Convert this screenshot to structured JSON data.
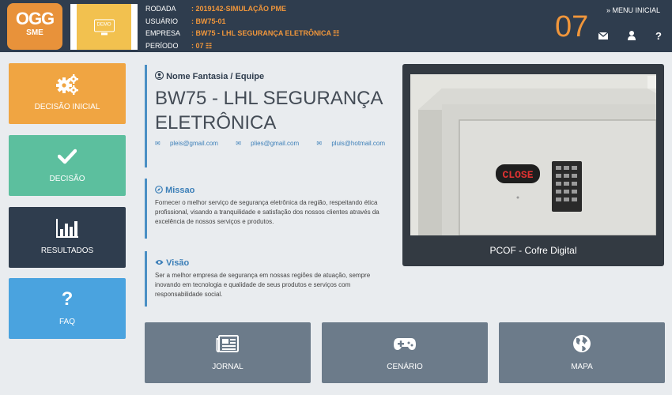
{
  "header": {
    "logo_line1": "OGG",
    "logo_line2": "SME",
    "demo_label": "DEMO",
    "info": [
      {
        "label": "RODADA",
        "value": ": 2019142-SIMULAÇÃO PME"
      },
      {
        "label": "USUÁRIO",
        "value": ": BW75-01"
      },
      {
        "label": "EMPRESA",
        "value": ": BW75 - LHL SEGURANÇA ELETRÔNICA ☷"
      },
      {
        "label": "PERÍODO",
        "value": ": 07 ☷"
      }
    ],
    "period_big": "07",
    "menu_inicial": "» MENU INICIAL",
    "icons": [
      "envelope-icon",
      "user-icon",
      "question-icon"
    ]
  },
  "sidebar": {
    "items": [
      {
        "label": "DECISÃO INICIAL",
        "color": "#f0a542",
        "icon": "gears-icon"
      },
      {
        "label": "DECISÃO",
        "color": "#5cbf9e",
        "icon": "check-icon"
      },
      {
        "label": "RESULTADOS",
        "color": "#2f3d4e",
        "icon": "bar-chart-icon"
      },
      {
        "label": "FAQ",
        "color": "#4aa3df",
        "icon": "question-icon"
      }
    ]
  },
  "company": {
    "heading": "Nome Fantasia / Equipe",
    "name": "BW75 - LHL SEGURANÇA ELETRÔNICA",
    "emails": [
      "pleis@gmail.com",
      "plies@gmail.com",
      "pluis@hotmail.com"
    ]
  },
  "missao": {
    "title": "Missao",
    "text": "Fornecer o melhor serviço de segurança eletrônica da região, respeitando ética profissional, visando a tranquilidade e satisfação dos nossos clientes através da excelência de nossos serviços e produtos."
  },
  "visao": {
    "title": "Visão",
    "text": "Ser a melhor empresa de segurança em nossas regiões de atuação, sempre inovando em tecnologia e qualidade de seus produtos e serviços com responsabilidade social."
  },
  "product": {
    "caption": "PCOF - Cofre Digital",
    "display_text": "CLOSE"
  },
  "bottom": {
    "items": [
      {
        "label": "JORNAL",
        "icon": "newspaper-icon"
      },
      {
        "label": "CENÁRIO",
        "icon": "gamepad-icon"
      },
      {
        "label": "MAPA",
        "icon": "globe-icon"
      }
    ]
  }
}
